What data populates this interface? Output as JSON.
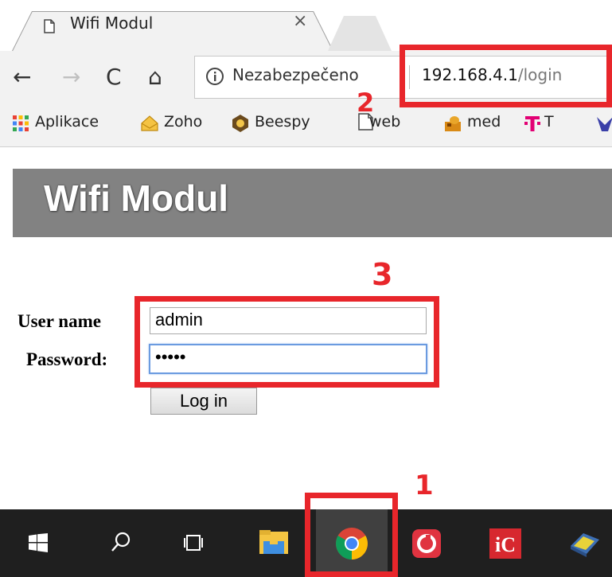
{
  "browser": {
    "tab": {
      "title": "Wifi Modul",
      "close_glyph": "×"
    },
    "nav": {
      "back_glyph": "←",
      "forward_glyph": "→",
      "reload_glyph": "C",
      "home_glyph": "⌂"
    },
    "address": {
      "security_text": "Nezabezpečeno",
      "host": "192.168.4.1",
      "path": "/login"
    },
    "bookmarks": [
      {
        "label": "Aplikace",
        "icon": "apps-grid-icon"
      },
      {
        "label": "Zoho",
        "icon": "zoho-icon"
      },
      {
        "label": "Beespy",
        "icon": "beespy-icon"
      },
      {
        "label": "web",
        "icon": "doc-icon"
      },
      {
        "label": "med",
        "icon": "med-icon"
      },
      {
        "label": "T",
        "icon": "t-mobile-icon"
      }
    ]
  },
  "page": {
    "title": "Wifi Modul",
    "form": {
      "username_label": "User name",
      "username_value": "admin",
      "password_label": "Password:",
      "password_value": "•••••",
      "login_label": "Log in"
    }
  },
  "annotations": {
    "n1": "1",
    "n2": "2",
    "n3": "3",
    "color": "#e8262b"
  },
  "taskbar": {
    "apps": [
      "start-icon",
      "search-icon",
      "task-view-icon",
      "file-explorer-icon",
      "chrome-icon",
      "red-app-icon",
      "ic-app-icon",
      "monitor-app-icon"
    ]
  }
}
